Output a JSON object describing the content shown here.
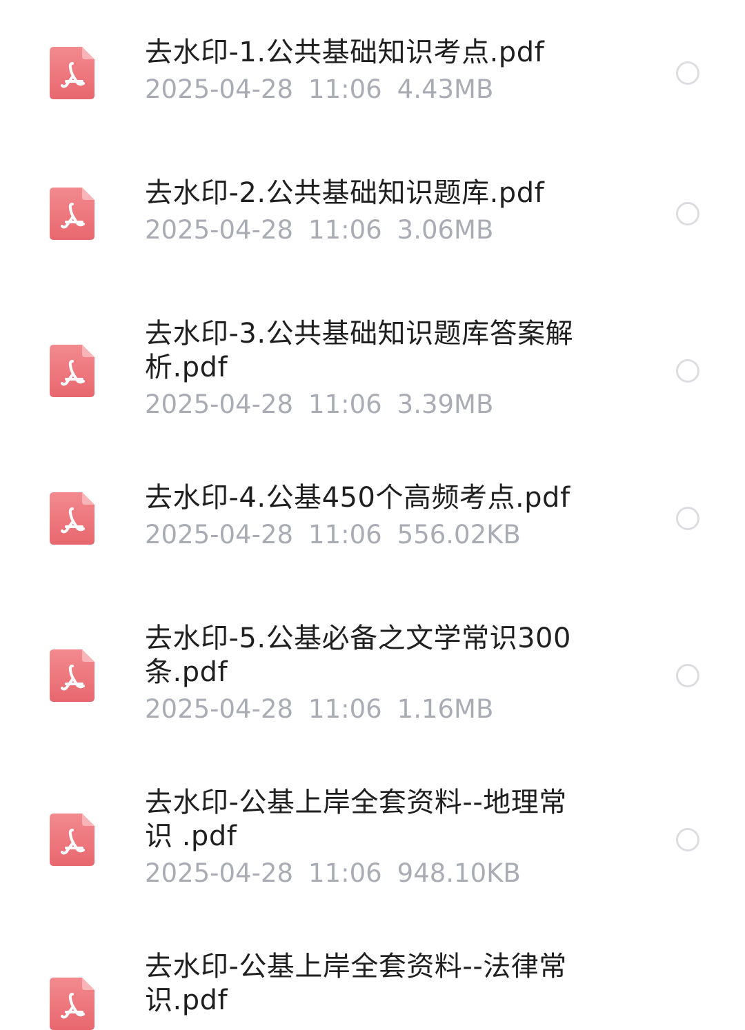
{
  "files": [
    {
      "name": "去水印-1.公共基础知识考点.pdf",
      "date": "2025-04-28",
      "time": "11:06",
      "size": "4.43MB",
      "selected": false
    },
    {
      "name": "去水印-2.公共基础知识题库.pdf",
      "date": "2025-04-28",
      "time": "11:06",
      "size": "3.06MB",
      "selected": false
    },
    {
      "name": "去水印-3.公共基础知识题库答案解析.pdf",
      "date": "2025-04-28",
      "time": "11:06",
      "size": "3.39MB",
      "selected": false
    },
    {
      "name": "去水印-4.公基450个高频考点.pdf",
      "date": "2025-04-28",
      "time": "11:06",
      "size": "556.02KB",
      "selected": false
    },
    {
      "name": "去水印-5.公基必备之文学常识300条.pdf",
      "date": "2025-04-28",
      "time": "11:06",
      "size": "1.16MB",
      "selected": false
    },
    {
      "name": "去水印-公基上岸全套资料--地理常识 .pdf",
      "date": "2025-04-28",
      "time": "11:06",
      "size": "948.10KB",
      "selected": false
    },
    {
      "name": "去水印-公基上岸全套资料--法律常识.pdf",
      "date": "",
      "time": "",
      "size": "",
      "selected": false
    }
  ],
  "icons": {
    "file_type_icon": "pdf-file-icon",
    "select_control": "radio-circle-icon"
  },
  "colors": {
    "pdf_icon_top": "#f28a8f",
    "pdf_icon_bottom": "#e8676e",
    "filename_text": "#1f1f1f",
    "meta_text": "#a9acb5",
    "radio_border": "#dcdde1"
  }
}
